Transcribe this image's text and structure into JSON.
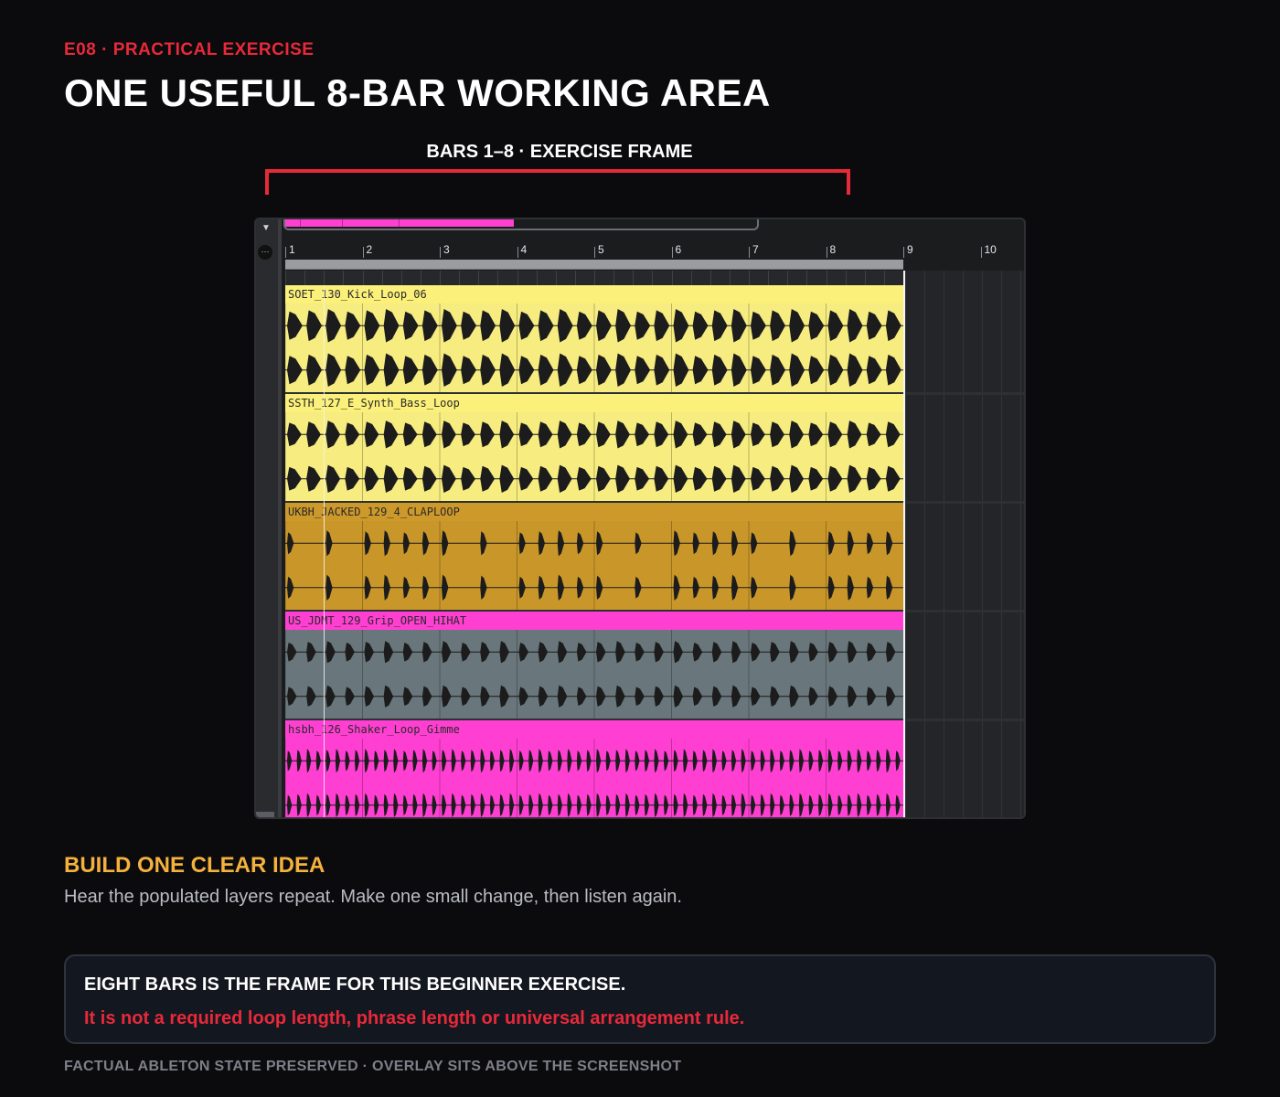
{
  "header": {
    "eyebrow": "E08  ·  PRACTICAL EXERCISE",
    "title": "ONE USEFUL 8-BAR WORKING AREA"
  },
  "frame": {
    "label": "BARS 1–8 · EXERCISE FRAME",
    "color": "#e8293a"
  },
  "daw": {
    "ruler": [
      "1",
      "2",
      "3",
      "4",
      "5",
      "6",
      "7",
      "8",
      "9",
      "10"
    ],
    "scroll_progress": 0.48,
    "tracks": [
      {
        "name": "SOET_130_Kick_Loop_06",
        "header_color": "#fbf07a",
        "body_color": "#f6ec7f",
        "wave": "kick"
      },
      {
        "name": "SSTH_127_E_Synth_Bass_Loop",
        "header_color": "#fbf07a",
        "body_color": "#f6ec7f",
        "wave": "bass"
      },
      {
        "name": "UKBH_JACKED_129_4_CLAPLOOP",
        "header_color": "#cd992a",
        "body_color": "#c9962a",
        "wave": "clap"
      },
      {
        "name": "US_JDMT_129_Grip_OPEN_HIHAT",
        "header_color": "#ff3fd2",
        "body_color": "#69767b",
        "wave": "hat"
      },
      {
        "name": "hsbh_126_Shaker_Loop_Gimme",
        "header_color": "#ff3fd2",
        "body_color": "#ff3fd2",
        "wave": "shaker"
      }
    ]
  },
  "content": {
    "subhead": "BUILD ONE CLEAR IDEA",
    "description": "Hear the populated layers repeat. Make one small change, then listen again."
  },
  "note": {
    "line1": "EIGHT BARS IS THE FRAME FOR THIS BEGINNER EXERCISE.",
    "line2": "It is not a required loop length, phrase length or universal arrangement rule."
  },
  "footer": "FACTUAL ABLETON STATE PRESERVED · OVERLAY SITS ABOVE THE SCREENSHOT"
}
